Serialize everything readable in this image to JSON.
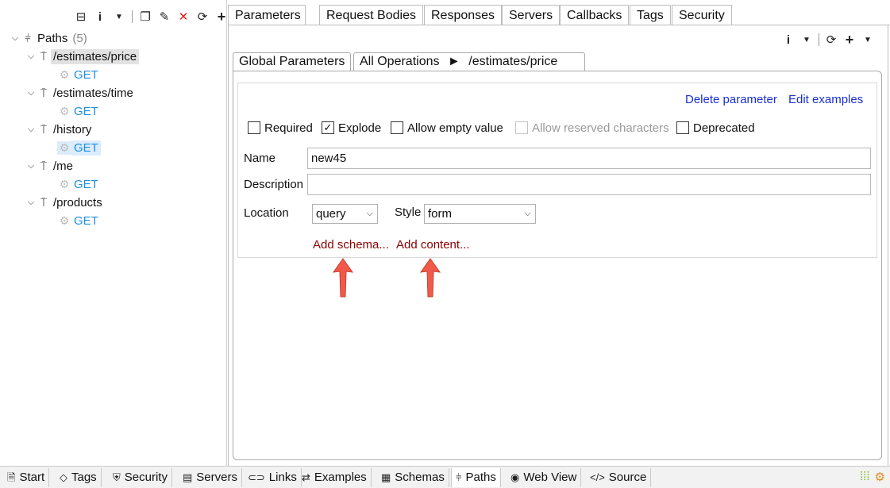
{
  "tree": {
    "root_label": "Paths",
    "root_count": "(5)",
    "paths": [
      {
        "label": "/estimates/price",
        "method": "GET"
      },
      {
        "label": "/estimates/time",
        "method": "GET"
      },
      {
        "label": "/history",
        "method": "GET"
      },
      {
        "label": "/me",
        "method": "GET"
      },
      {
        "label": "/products",
        "method": "GET"
      }
    ]
  },
  "top_tabs": [
    "Parameters",
    "Request Bodies",
    "Responses",
    "Servers",
    "Callbacks",
    "Tags",
    "Security"
  ],
  "sub_tabs": {
    "global": "Global Parameters",
    "ops_prefix": "All Operations",
    "ops_arrow": "►",
    "ops_path": "/estimates/price"
  },
  "actions": {
    "delete": "Delete parameter",
    "edit_examples": "Edit examples"
  },
  "checkboxes": [
    {
      "label": "Required",
      "checked": false,
      "disabled": false
    },
    {
      "label": "Explode",
      "checked": true,
      "disabled": false
    },
    {
      "label": "Allow empty value",
      "checked": false,
      "disabled": false
    },
    {
      "label": "Allow reserved characters",
      "checked": false,
      "disabled": true
    },
    {
      "label": "Deprecated",
      "checked": false,
      "disabled": false
    }
  ],
  "fields": {
    "name_label": "Name",
    "name_value": "new45",
    "description_label": "Description",
    "description_value": "",
    "location_label": "Location",
    "location_value": "query",
    "style_label": "Style",
    "style_value": "form"
  },
  "add_links": {
    "schema": "Add schema...",
    "content": "Add content..."
  },
  "bottom_tabs": [
    "Start",
    "Tags",
    "Security",
    "Servers",
    "Links",
    "Examples",
    "Schemas",
    "Paths",
    "Web View",
    "Source"
  ],
  "active_bottom_tab": "Paths",
  "colors": {
    "link_blue": "#1a2fd0",
    "add_link": "#8b0000",
    "get_method": "#1e8fe0",
    "arrow_red": "#f15a4a"
  }
}
